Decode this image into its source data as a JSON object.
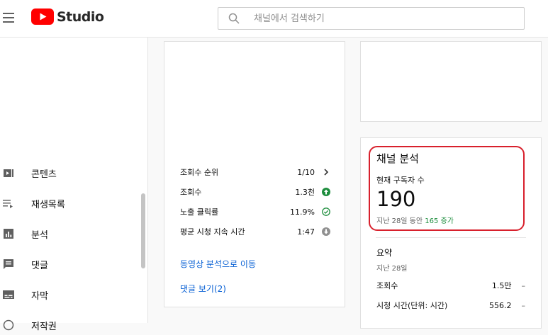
{
  "header": {
    "logo_text": "Studio",
    "search_placeholder": "채널에서 검색하기"
  },
  "sidebar": {
    "items": [
      {
        "label": "콘텐츠",
        "icon": "video-content-icon"
      },
      {
        "label": "재생목록",
        "icon": "playlist-icon"
      },
      {
        "label": "분석",
        "icon": "analytics-icon"
      },
      {
        "label": "댓글",
        "icon": "comments-icon"
      },
      {
        "label": "자막",
        "icon": "subtitles-icon"
      },
      {
        "label": "저작권",
        "icon": "copyright-icon"
      }
    ]
  },
  "video_card": {
    "stats": [
      {
        "label": "조회수 순위",
        "value": "1/10",
        "icon": "chevron-right-icon"
      },
      {
        "label": "조회수",
        "value": "1.3천",
        "icon": "arrow-up-circle-icon"
      },
      {
        "label": "노출 클릭률",
        "value": "11.9%",
        "icon": "check-circle-icon"
      },
      {
        "label": "평균 시청 지속 시간",
        "value": "1:47",
        "icon": "arrow-down-circle-icon"
      }
    ],
    "analytics_link": "동영상 분석으로 이동",
    "comments_link": "댓글 보기(2)"
  },
  "channel_analytics": {
    "title": "채널 분석",
    "subscribers_label": "현재 구독자 수",
    "subscribers_count": "190",
    "change_prefix": "지난 28일 동안",
    "change_value": "165 증가",
    "summary_title": "요약",
    "summary_period": "지난 28일",
    "summary": [
      {
        "label": "조회수",
        "value": "1.5만",
        "trend": "–"
      },
      {
        "label": "시청 시간(단위: 시간)",
        "value": "556.2",
        "trend": "–"
      }
    ]
  },
  "colors": {
    "brand_red": "#ff0000",
    "link_blue": "#065fd4",
    "positive_green": "#1e8e3e",
    "highlight_red": "#d8202c"
  }
}
